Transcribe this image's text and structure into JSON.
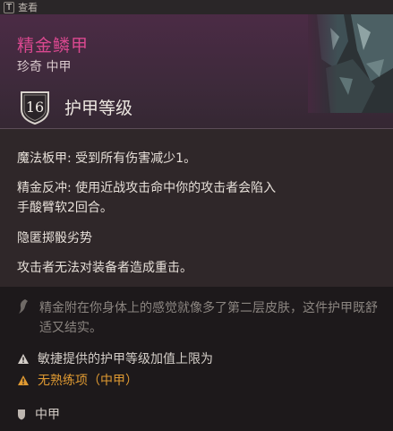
{
  "topbar": {
    "key": "T",
    "label": "查看"
  },
  "item": {
    "name": "精金鳞甲",
    "subtitle": "珍奇 中甲",
    "armor_class": "16",
    "armor_class_label": "护甲等级"
  },
  "properties": [
    "魔法板甲: 受到所有伤害减少1。",
    "精金反冲: 使用近战攻击命中你的攻击者会陷入",
    "手酸臂软2回合。",
    "隐匿掷骰劣势",
    "攻击者无法对装备者造成重击。"
  ],
  "flavor": "精金附在你身体上的感觉就像多了第二层皮肤，这件护甲既舒适又结实。",
  "warnings": [
    {
      "text": "敏捷提供的护甲等级加值上限为",
      "color": "#d4cec8",
      "icon": "warning-icon-grey"
    },
    {
      "text": "无熟练项（中甲）",
      "color": "#e09a32",
      "icon": "warning-icon-orange"
    }
  ],
  "armor_type": "中甲",
  "colors": {
    "title": "#d9488f",
    "warning": "#e09a32"
  }
}
